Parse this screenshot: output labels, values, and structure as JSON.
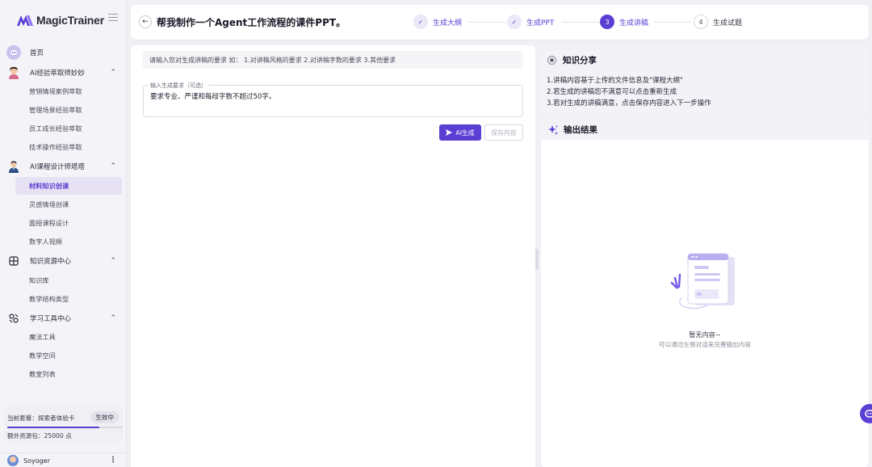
{
  "app": {
    "name": "MagicTrainer"
  },
  "sidebar": {
    "items": [
      {
        "label": "首页",
        "icon": "home-icon"
      },
      {
        "label": "AI经验萃取师妙妙",
        "icon": "avatar-icon",
        "expanded": true,
        "children": [
          "营销情境案例萃取",
          "管理场景经验萃取",
          "员工成长经验萃取",
          "技术操作经验萃取"
        ]
      },
      {
        "label": "AI课程设计师塔塔",
        "icon": "avatar-icon",
        "expanded": true,
        "children": [
          "材料知识创课",
          "灵感情境创课",
          "面授课程设计",
          "数字人视频"
        ],
        "active_child": "材料知识创课"
      },
      {
        "label": "知识资源中心",
        "icon": "knowledge-icon",
        "expanded": true,
        "children": [
          "知识库",
          "教学结构类型"
        ]
      },
      {
        "label": "学习工具中心",
        "icon": "tools-icon",
        "expanded": true,
        "children": [
          "魔法工具",
          "教学空间",
          "教室列表"
        ]
      }
    ],
    "plan": {
      "label": "当前套餐：探索者体验卡",
      "status": "生效中",
      "progress": 0.8,
      "extra": "额外资源包：25000 点"
    },
    "user": {
      "name": "Soyoger"
    }
  },
  "header": {
    "title": "帮我制作一个Agent工作流程的课件PPT。",
    "steps": [
      {
        "label": "生成大纲",
        "state": "done"
      },
      {
        "label": "生成PPT",
        "state": "done"
      },
      {
        "label": "生成讲稿",
        "state": "active",
        "num": "3"
      },
      {
        "label": "生成试题",
        "state": "todo",
        "num": "4"
      }
    ]
  },
  "editor": {
    "hint": "请输入您对生成讲稿的要求 如： 1.对讲稿风格的要求 2.对讲稿字数的要求 3.其他要求",
    "input_label": "输入生成要求（可选）",
    "input_value": "要求专业、严谨和每段字数不超过50字。",
    "ai_button": "AI生成",
    "save_button": "保存内容"
  },
  "knowledge": {
    "title": "知识分享",
    "lines": [
      "1.讲稿内容基于上传的文件信息及\"课程大纲\"",
      "2.若生成的讲稿您不满意可以点击重新生成",
      "3.若对生成的讲稿满意，点击保存内容进入下一步操作"
    ]
  },
  "result": {
    "title": "输出结果",
    "empty_title": "暂无内容~",
    "empty_sub": "可以通过左侧对话来完善输出内容"
  },
  "colors": {
    "accent": "#5b3fd4",
    "sidebar_bg": "#f4f4f8",
    "page_bg": "#f0f0f5"
  }
}
